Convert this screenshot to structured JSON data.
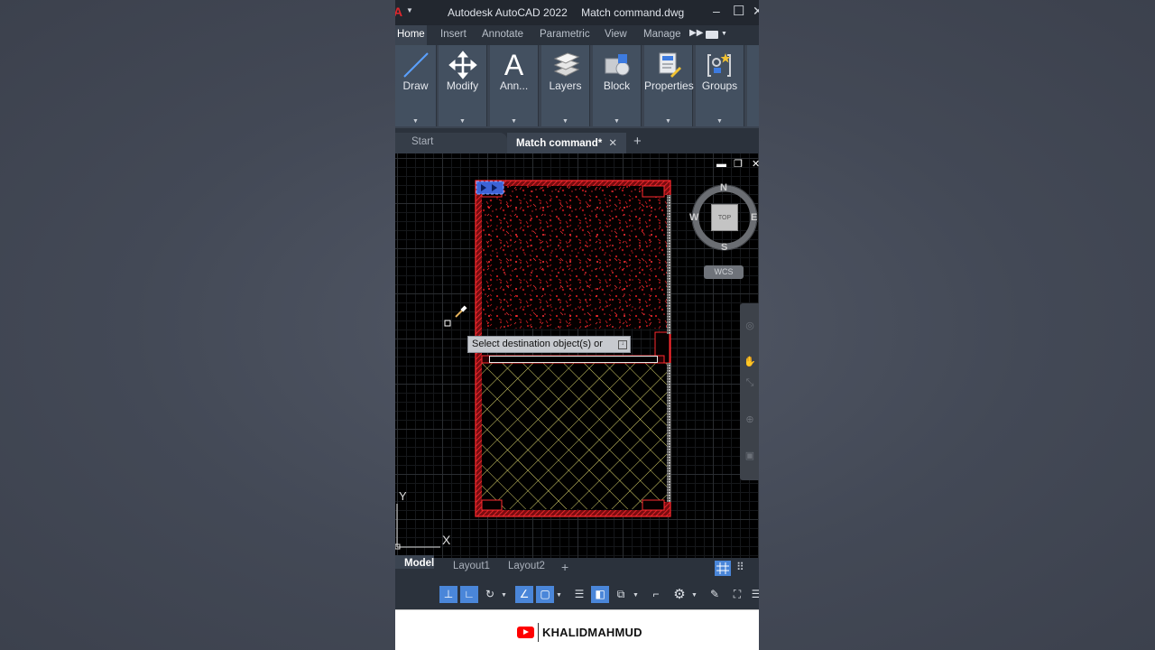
{
  "titlebar": {
    "logo": "A",
    "app": "Autodesk AutoCAD 2022",
    "file": "Match command.dwg"
  },
  "ribbon_tabs": [
    "Home",
    "Insert",
    "Annotate",
    "Parametric",
    "View",
    "Manage"
  ],
  "ribbon_panels": [
    "Draw",
    "Modify",
    "Ann...",
    "Layers",
    "Block",
    "Properties",
    "Groups"
  ],
  "file_tabs": {
    "start": "Start",
    "active": "Match command*",
    "close": "✕",
    "new": "+"
  },
  "viewcube": {
    "north": "N",
    "south": "S",
    "east": "E",
    "west": "W",
    "face": "TOP",
    "wcs": "WCS"
  },
  "command_tooltip": "Select destination object(s) or",
  "ucs": {
    "y": "Y",
    "x": "X"
  },
  "layout_tabs": [
    "Model",
    "Layout1",
    "Layout2"
  ],
  "layout_add": "+",
  "colors": {
    "wall": "#e01f25",
    "hatch_top": "#d01a1a",
    "hatch_bottom": "#d8d26a",
    "selected": "#3d63d6",
    "accent": "#4a86d9"
  },
  "footer": {
    "channel": "KHALIDMAHMUD"
  }
}
